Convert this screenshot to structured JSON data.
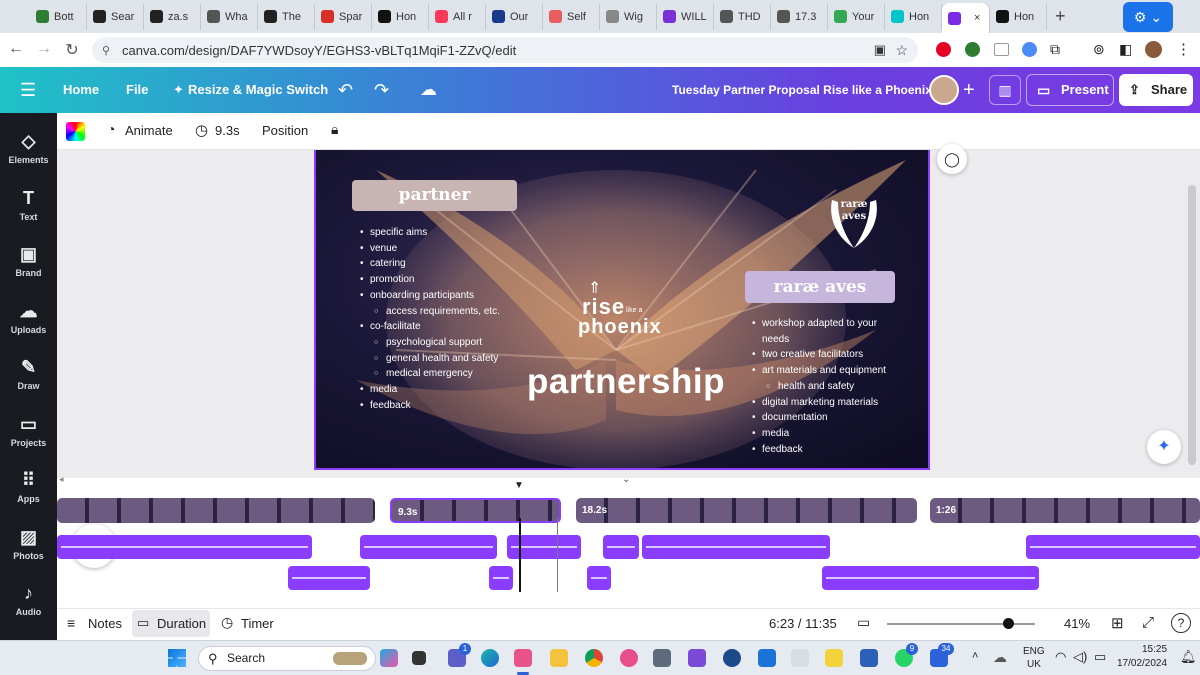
{
  "browser": {
    "tabs": [
      {
        "label": "Bott",
        "icon": "brand-icon",
        "color": "#2e7d32"
      },
      {
        "label": "Sear",
        "icon": "s-icon",
        "color": "#222222"
      },
      {
        "label": "za.s",
        "icon": "s-icon",
        "color": "#222222"
      },
      {
        "label": "Wha",
        "icon": "globe-icon",
        "color": "#555555"
      },
      {
        "label": "The",
        "icon": "w-icon",
        "color": "#222222"
      },
      {
        "label": "Spar",
        "icon": "gmail-icon",
        "color": "#d93025"
      },
      {
        "label": "Hon",
        "icon": "x-icon",
        "color": "#111111"
      },
      {
        "label": "All r",
        "icon": "airbnb-icon",
        "color": "#ff385c"
      },
      {
        "label": "Our",
        "icon": "app-icon",
        "color": "#1a3a8a"
      },
      {
        "label": "Self",
        "icon": "bars-icon",
        "color": "#e85d5d"
      },
      {
        "label": "Wig",
        "icon": "bulb-icon",
        "color": "#888888"
      },
      {
        "label": "WILL",
        "icon": "check-icon",
        "color": "#7b2fd6"
      },
      {
        "label": "THD",
        "icon": "globe-icon",
        "color": "#555555"
      },
      {
        "label": "17.3",
        "icon": "globe-icon",
        "color": "#555555"
      },
      {
        "label": "Your",
        "icon": "maps-icon",
        "color": "#34a853"
      },
      {
        "label": "Hon",
        "icon": "canva-icon",
        "color": "#00c4cc"
      },
      {
        "label": "",
        "icon": "canva-active-icon",
        "color": "#7d2ae8",
        "active": true
      },
      {
        "label": "Hon",
        "icon": "x-icon",
        "color": "#111111"
      }
    ],
    "new_tab": "+",
    "url": "canva.com/design/DAF7YWDsoyY/EGHS3-vBLTq1MqiF1-ZZvQ/edit"
  },
  "header": {
    "menu": "☰",
    "home": "Home",
    "file": "File",
    "resize": "Resize & Magic Switch",
    "title": "Tuesday Partner Proposal Rise like a Phoenix",
    "present": "Present",
    "share": "Share"
  },
  "rail": [
    {
      "label": "Elements",
      "icon": "elements-icon",
      "glyph": "◇"
    },
    {
      "label": "Text",
      "icon": "text-icon",
      "glyph": "T"
    },
    {
      "label": "Brand",
      "icon": "brand-kit-icon",
      "glyph": "▣"
    },
    {
      "label": "Uploads",
      "icon": "upload-icon",
      "glyph": "☁"
    },
    {
      "label": "Draw",
      "icon": "pen-icon",
      "glyph": "✎"
    },
    {
      "label": "Projects",
      "icon": "folder-icon",
      "glyph": "▭"
    },
    {
      "label": "Apps",
      "icon": "apps-icon",
      "glyph": "⠿"
    },
    {
      "label": "Photos",
      "icon": "photo-icon",
      "glyph": "▨"
    },
    {
      "label": "Audio",
      "icon": "music-icon",
      "glyph": "♪"
    }
  ],
  "toolbar": {
    "animate": "Animate",
    "duration": "9.3s",
    "position": "Position"
  },
  "slide": {
    "partner_heading": "partner",
    "partner_items": [
      {
        "text": "specific aims",
        "sub": false
      },
      {
        "text": "venue",
        "sub": false
      },
      {
        "text": "catering",
        "sub": false
      },
      {
        "text": "promotion",
        "sub": false
      },
      {
        "text": "onboarding participants",
        "sub": false
      },
      {
        "text": "access requirements, etc.",
        "sub": true
      },
      {
        "text": "co-facilitate",
        "sub": false
      },
      {
        "text": "psychological support",
        "sub": true
      },
      {
        "text": "general health and safety",
        "sub": true
      },
      {
        "text": "medical emergency",
        "sub": true
      },
      {
        "text": "media",
        "sub": false
      },
      {
        "text": "feedback",
        "sub": false
      }
    ],
    "logo_rise": "rise",
    "logo_like_a": "like a",
    "logo_phoenix": "phoenix",
    "partnership": "partnership",
    "rarae_logo_line1": "raræ",
    "rarae_logo_line2": "aves",
    "rarae_heading": "raræ aves",
    "rarae_items": [
      {
        "text": "workshop adapted to your",
        "sub": false
      },
      {
        "text": "needs",
        "sub": false,
        "cont": true
      },
      {
        "text": "two creative facilitators",
        "sub": false
      },
      {
        "text": "art materials and equipment",
        "sub": false
      },
      {
        "text": "health and safety",
        "sub": true
      },
      {
        "text": "digital marketing materials",
        "sub": false
      },
      {
        "text": "documentation",
        "sub": false
      },
      {
        "text": "media",
        "sub": false
      },
      {
        "text": "feedback",
        "sub": false
      }
    ]
  },
  "timeline": {
    "clips": [
      {
        "label": ""
      },
      {
        "label": "9.3s"
      },
      {
        "label": "18.2s"
      },
      {
        "label": "1:26"
      }
    ]
  },
  "bottom": {
    "notes": "Notes",
    "duration": "Duration",
    "timer": "Timer",
    "time": "6:23 / 11:35",
    "zoom": "41%",
    "zoom_level": 0.41
  },
  "taskbar": {
    "search": "Search",
    "lang1": "ENG",
    "lang2": "UK",
    "time": "15:25",
    "date": "17/02/2024",
    "badges": [
      "1",
      "9",
      "34"
    ]
  }
}
